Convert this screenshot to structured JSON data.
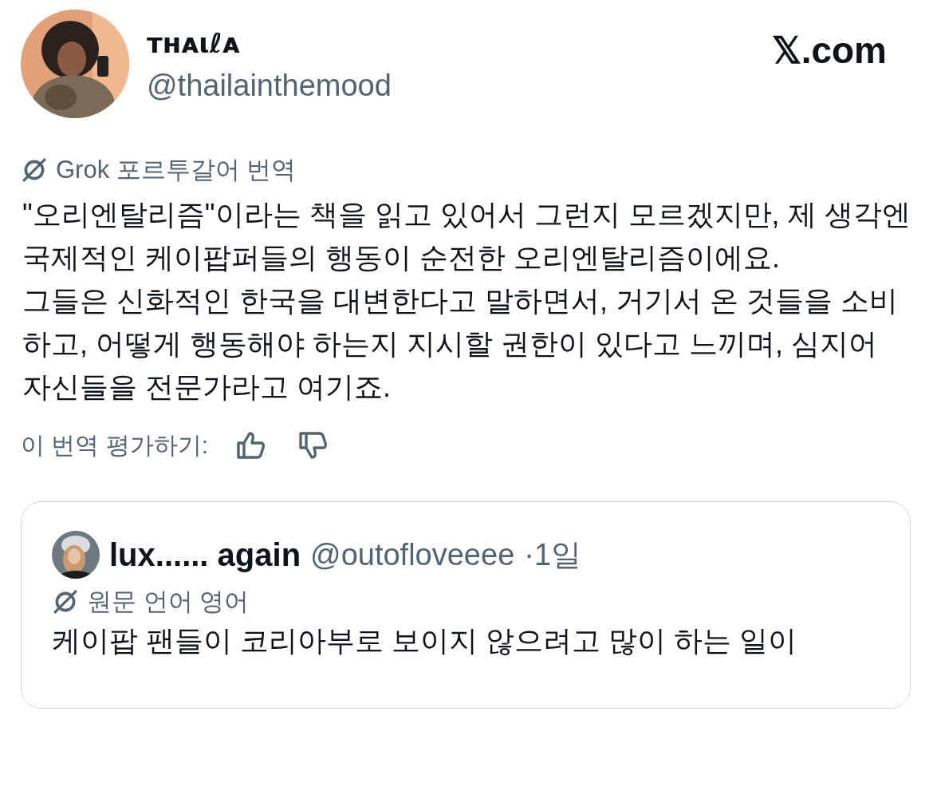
{
  "author": {
    "name": "ᴛʜᴀιℓᴀ",
    "handle": "@thailainthemood"
  },
  "site": "𝕏.com",
  "translation": {
    "label": "Grok 포르투갈어 번역"
  },
  "body": [
    "\"오리엔탈리즘\"이라는 책을 읽고 있어서 그런지 모르겠지만, 제 생각엔 국제적인 케이팝퍼들의 행동이 순전한 오리엔탈리즘이에요.",
    "그들은 신화적인 한국을 대변한다고 말하면서, 거기서 온 것들을 소비하고, 어떻게 행동해야 하는지 지시할 권한이 있다고 느끼며, 심지어 자신들을 전문가라고 여기죠."
  ],
  "rating": {
    "label": "이 번역 평가하기:"
  },
  "quote": {
    "name": "lux...... again",
    "handle": "@outofloveeee",
    "time": "·1일",
    "language": "원문 언어 영어",
    "text": "케이팝 팬들이 코리아부로 보이지 않으려고 많이 하는 일이"
  }
}
